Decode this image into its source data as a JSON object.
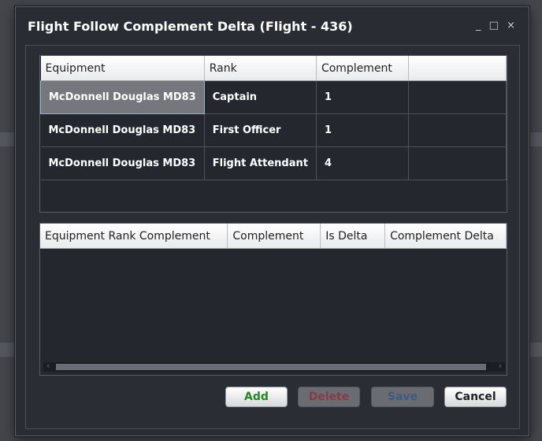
{
  "dialog": {
    "title": "Flight Follow Complement Delta (Flight - 436)",
    "controls": {
      "minimize": "_",
      "maximize": "□",
      "close": "×"
    }
  },
  "top_grid": {
    "headers": [
      "Equipment",
      "Rank",
      "Complement",
      ""
    ],
    "rows": [
      {
        "equipment": "McDonnell Douglas MD83",
        "rank": "Captain",
        "complement": "1"
      },
      {
        "equipment": "McDonnell Douglas MD83",
        "rank": "First Officer",
        "complement": "1"
      },
      {
        "equipment": "McDonnell Douglas MD83",
        "rank": "Flight Attendant",
        "complement": "4"
      }
    ]
  },
  "bottom_grid": {
    "headers": [
      "Equipment Rank Complement",
      "Complement",
      "Is Delta",
      "Complement Delta"
    ]
  },
  "buttons": {
    "add": "Add",
    "delete": "Delete",
    "save": "Save",
    "cancel": "Cancel"
  },
  "colors": {
    "add_text": "#1f8a1f",
    "delete_text": "#8a3a45",
    "save_text": "#3a5a8a"
  }
}
